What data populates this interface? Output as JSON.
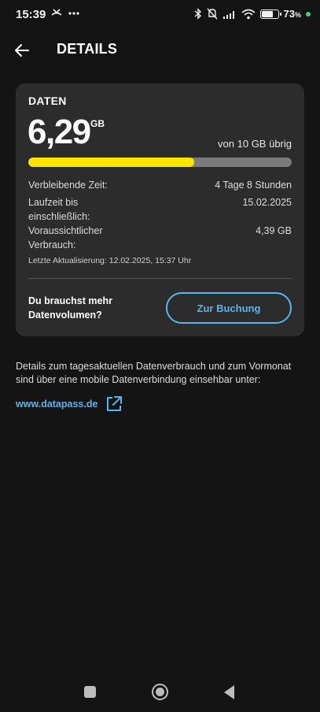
{
  "status_bar": {
    "time": "15:39",
    "battery_percent": "73",
    "battery_suffix": "%",
    "battery_level": 0.73,
    "icons_left": [
      "missed-call-icon",
      "more-dots-icon"
    ],
    "icons_right": [
      "bluetooth-icon",
      "mute-bell-icon",
      "signal-icon",
      "wifi-icon",
      "battery-icon"
    ]
  },
  "header": {
    "title": "DETAILS"
  },
  "card": {
    "label": "DATEN",
    "amount": "6,29",
    "unit": "GB",
    "remaining_text": "von 10 GB übrig",
    "usage_fraction": 0.629,
    "rows": [
      {
        "label": "Verbleibende Zeit:",
        "value": "4 Tage 8 Stunden"
      },
      {
        "label": "Laufzeit bis einschließlich:",
        "value": "15.02.2025"
      },
      {
        "label": "Voraussichtlicher Verbrauch:",
        "value": "4,39 GB"
      }
    ],
    "last_update": "Letzte Aktualisierung: 12.02.2025, 15:37 Uhr",
    "upsell_text": "Du brauchst mehr Datenvolumen?",
    "cta_label": "Zur Buchung"
  },
  "info": {
    "text": "Details zum tagesaktuellen Datenverbrauch und zum Vormonat sind über eine mobile Datenverbindung einsehbar unter:",
    "link": "www.datapass.de"
  },
  "colors": {
    "background": "#141414",
    "card": "#2c2c2c",
    "accent": "#5ab4f0",
    "progress_fill": "#ffe500",
    "progress_track": "#7a7a7a"
  }
}
